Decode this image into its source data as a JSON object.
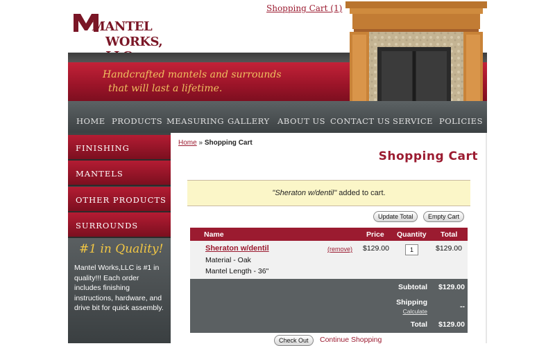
{
  "header": {
    "logo_line1": "MANTEL",
    "logo_line2": "WORKS, LLC.",
    "cart_link": "Shopping Cart (1)",
    "tagline_line1": "Handcrafted mantels and surrounds",
    "tagline_line2": "that will last a lifetime."
  },
  "nav": {
    "items": [
      "HOME",
      "PRODUCTS",
      "MEASURING",
      "GALLERY",
      "ABOUT US",
      "CONTACT US",
      "SERVICE",
      "POLICIES"
    ]
  },
  "sidebar": {
    "items": [
      "FINISHING",
      "MANTELS",
      "OTHER PRODUCTS",
      "SURROUNDS"
    ],
    "quality_title": "#1 in Quality!",
    "quality_text": "Mantel Works,LLC is #1 in quality!!! Each order includes finishing instructions, hardware, and drive bit for quick assembly."
  },
  "main": {
    "breadcrumb_home": "Home",
    "breadcrumb_sep": " » ",
    "breadcrumb_current": "Shopping Cart",
    "title": "Shopping Cart",
    "notice_item": "\"Sheraton w/dentil\"",
    "notice_suffix": " added to cart.",
    "update_total": "Update Total",
    "empty_cart": "Empty Cart"
  },
  "cart": {
    "headers": {
      "name": "Name",
      "price": "Price",
      "quantity": "Quantity",
      "total": "Total"
    },
    "item": {
      "name": "Sheraton w/dentil",
      "options": [
        "Material - Oak",
        "Mantel Length - 36\""
      ],
      "remove": "(remove)",
      "price": "$129.00",
      "quantity": "1",
      "total": "$129.00"
    },
    "subtotal_label": "Subtotal",
    "subtotal_value": "$129.00",
    "shipping_label": "Shipping",
    "shipping_calc": "Calculate",
    "shipping_value": "--",
    "total_label": "Total",
    "total_value": "$129.00"
  },
  "actions": {
    "checkout": "Check Out",
    "continue": "Continue Shopping"
  },
  "colors": {
    "brand_red": "#9b1b30",
    "nav_gray": "#4a4f51",
    "notice_yellow": "#fbf6c8",
    "tagline_gold": "#f0c060"
  }
}
